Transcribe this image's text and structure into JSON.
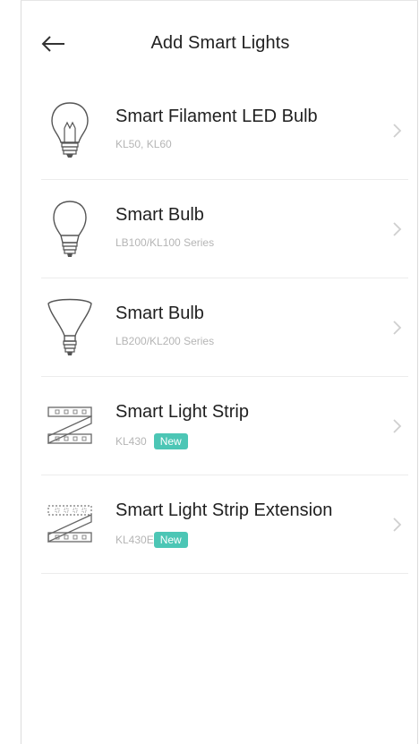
{
  "header": {
    "title": "Add Smart Lights"
  },
  "devices": [
    {
      "name": "Smart Filament LED Bulb",
      "models": "KL50, KL60",
      "badge": "",
      "icon": "filament-bulb-icon"
    },
    {
      "name": "Smart Bulb",
      "models": "LB100/KL100 Series",
      "badge": "",
      "icon": "a19-bulb-icon"
    },
    {
      "name": "Smart Bulb",
      "models": "LB200/KL200 Series",
      "badge": "",
      "icon": "br30-bulb-icon"
    },
    {
      "name": "Smart Light Strip",
      "models": "KL430",
      "badge": "New",
      "icon": "light-strip-icon"
    },
    {
      "name": "Smart Light Strip Extension",
      "models": "KL430E",
      "badge": "New",
      "icon": "light-strip-extension-icon"
    }
  ],
  "colors": {
    "badge": "#4cc6b5",
    "divider": "#ececec",
    "subtext": "#b5b5b5"
  }
}
